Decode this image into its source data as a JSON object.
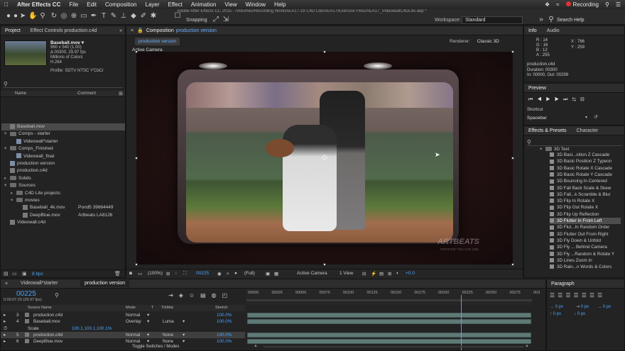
{
  "menubar": {
    "apple": "",
    "app": "After Effects CC",
    "items": [
      "File",
      "Edit",
      "Composition",
      "Layer",
      "Effect",
      "Animation",
      "View",
      "Window",
      "Help"
    ],
    "recording": "Recording"
  },
  "titlebar": {
    "title": "Adobe After Effects CC 2015 - /Volumes/Recording Work/AEA17-19 C4D Lite/AEA17/Exercise Files/AEA17_VideowallC4DLite.aep *"
  },
  "toolbar": {
    "snapping": "Snapping",
    "workspace_label": "Workspace:",
    "workspace_value": "Standard",
    "search_help": "Search Help"
  },
  "project": {
    "title": "Project",
    "effect_controls": "Effect Controls production.c4d",
    "item_name": "Baseball.mov ▾",
    "item_meta": [
      "960 x 540 (1.00)",
      "Δ 00300, 29.97 fps",
      "Millions of Colors",
      "H.264"
    ],
    "profile": "Profile: SDTV NTSC Y'CbCr",
    "search_placeholder": "",
    "col_name": "Name",
    "col_comment": "Comment",
    "items": [
      {
        "indent": 0,
        "type": "file",
        "name": "Baseball.mov",
        "comment": "",
        "selected": true
      },
      {
        "indent": 0,
        "type": "folder",
        "name": "Comps - starter",
        "comment": "",
        "open": true
      },
      {
        "indent": 1,
        "type": "comp",
        "name": "Videowall*starter",
        "comment": ""
      },
      {
        "indent": 0,
        "type": "folder",
        "name": "Comps_Finished",
        "comment": "",
        "open": true
      },
      {
        "indent": 1,
        "type": "comp",
        "name": "Videowall_final",
        "comment": ""
      },
      {
        "indent": 0,
        "type": "comp",
        "name": "production version",
        "comment": ""
      },
      {
        "indent": 0,
        "type": "file",
        "name": "production.c4d",
        "comment": ""
      },
      {
        "indent": 0,
        "type": "folder",
        "name": "Solids",
        "comment": ""
      },
      {
        "indent": 0,
        "type": "folder",
        "name": "Sources",
        "comment": "",
        "open": true
      },
      {
        "indent": 1,
        "type": "folder",
        "name": "C4D Lite projects",
        "comment": ""
      },
      {
        "indent": 1,
        "type": "folder",
        "name": "movies",
        "comment": "",
        "open": true
      },
      {
        "indent": 2,
        "type": "file",
        "name": "Baseball_4k.mov",
        "comment": "Pond5 39664449"
      },
      {
        "indent": 2,
        "type": "file",
        "name": "DeepBlue.mov",
        "comment": "Artbeats LA8126"
      },
      {
        "indent": 0,
        "type": "file",
        "name": "Videowall.c4d",
        "comment": ""
      }
    ],
    "bpc": "8 bpc"
  },
  "composition": {
    "tab_prefix": "Composition",
    "tab_name": "production version",
    "subtab": "production version",
    "renderer_label": "Renderer:",
    "renderer_value": "Classic 3D",
    "camera_label": "Active Camera",
    "watermark_line1": "ARTBEATS",
    "watermark_line2": "FOOTAGE YOU CAN USE",
    "bottom": {
      "zoom": "(100%)",
      "timecode": "00225",
      "resolution": "(Full)",
      "camera": "Active Camera",
      "views": "1 View",
      "exposure": "+0.0"
    }
  },
  "info": {
    "title": "Info",
    "audio": "Audio",
    "r": "R : 14",
    "g": "G : 16",
    "b": "B : 12",
    "a": "A : 255",
    "x": "X : 766",
    "y": "Y : 259",
    "name": "production.c4d",
    "duration": "Duration: 00300",
    "inout": "In: 00000, Out: 00299"
  },
  "preview": {
    "title": "Preview",
    "shortcut_label": "Shortcut",
    "shortcut_value": "Spacebar"
  },
  "effects": {
    "title": "Effects & Presets",
    "character": "Character",
    "search_placeholder": "",
    "folder": "3D Text",
    "items": [
      "3D Basi...sition Z Cascade",
      "3D Basic Position Z Typeon",
      "3D Basic Rotate X Cascade",
      "3D Basic Rotate Y Cascade",
      "3D Bouncing In Centered",
      "3D Fall Back Scale & Skew",
      "3D Fall...k Scramble & Blur",
      "3D Flip In Rotate X",
      "3D Flip Out Rotate X",
      "3D Flip Up Reflection",
      "3D Flutter In From Left",
      "3D Flut...In Random Order",
      "3D Flutter Out From Right",
      "3D Fly Down & Unfold",
      "3D Fly ... Behind Camera",
      "3D Fly ...Random & Rotate Y",
      "3D Lines Zoom In",
      "3D Rain...n Words & Colors"
    ],
    "highlighted_index": 10
  },
  "paragraph": {
    "title": "Paragraph",
    "values": [
      "0 px",
      "0 px",
      "0 px",
      "0 px",
      "0 px"
    ]
  },
  "timeline": {
    "tab1": "Videowall*starter",
    "tab2": "production version",
    "timecode": "00225",
    "timecode_sub": "0:00:07:15 (29.97 fps)",
    "col_source": "Source Name",
    "col_mode": "Mode",
    "col_t": "T",
    "col_trkmat": "TrkMat",
    "col_stretch": "Stretch",
    "layers": [
      {
        "num": "3",
        "name": "production.c4d",
        "mode": "Normal",
        "trkmat": "",
        "stretch": "100.0%"
      },
      {
        "num": "4",
        "name": "Baseball.mov",
        "mode": "Overlay",
        "trkmat": "Luma",
        "stretch": "100.0%"
      },
      {
        "num": "",
        "name": "Scale",
        "mode": "",
        "trkmat": "",
        "stretch": "",
        "value": "100.1,100.1,100.1%"
      },
      {
        "num": "5",
        "name": "production.c4d",
        "mode": "Normal",
        "trkmat": "None",
        "stretch": "100.0%"
      },
      {
        "num": "6",
        "name": "DeepBlue.mov",
        "mode": "Normal",
        "trkmat": "None",
        "stretch": "100.0%"
      }
    ],
    "ruler": [
      "00000",
      "00025",
      "00050",
      "00075",
      "00100",
      "00125",
      "00150",
      "00175",
      "00200",
      "00225",
      "00250",
      "00275",
      "003"
    ],
    "toggle_label": "Toggle Switches / Modes",
    "playhead_frame": 225
  },
  "colors": {
    "accent": "#4aa3ff",
    "highlight": "#5f7a76"
  }
}
